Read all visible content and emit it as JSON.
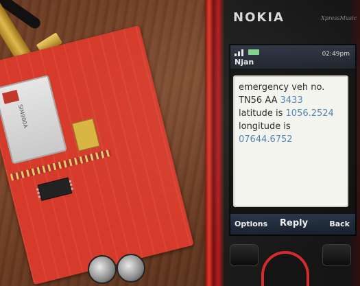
{
  "photo": {
    "subject": "Photograph of a red GSM development board next to a Nokia mobile phone showing an SMS"
  },
  "phone": {
    "brand": "NOKIA",
    "model": "XpressMusic",
    "status": {
      "label": "Njan",
      "time": "02:49pm",
      "signal_icon": "signal-icon",
      "battery_icon": "battery-icon"
    },
    "message": {
      "line1": "emergency veh no.",
      "line2_text": "TN56 AA ",
      "line2_num": "3433",
      "line3_text": "latitude is ",
      "line3_num": "1056.2524",
      "line4": "longitude is",
      "line5_num": "07644.6752"
    },
    "softkeys": {
      "left": "Options",
      "middle": "Reply",
      "right": "Back"
    }
  },
  "board": {
    "module_label": "SIM900A",
    "accent": "#d63a2a"
  },
  "colors": {
    "wood": "#6b3a22",
    "phone_red": "#d62b2b",
    "message_bg": "#f4f4ee",
    "link_number": "#4a7fb0"
  }
}
